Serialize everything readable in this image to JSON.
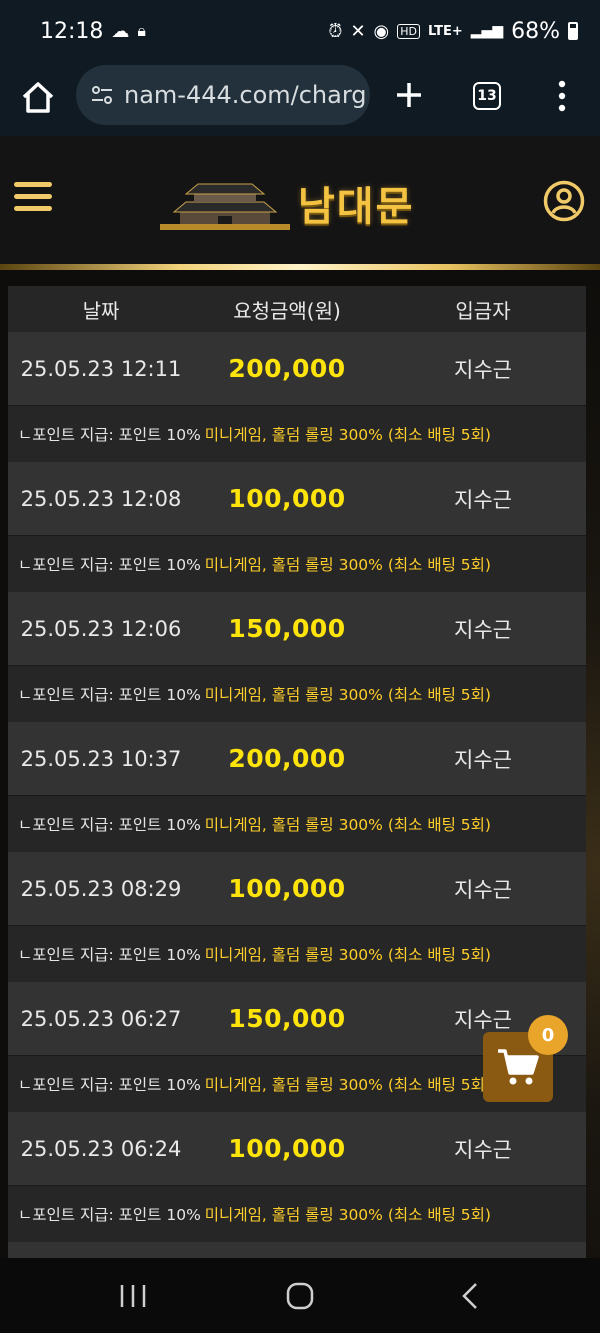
{
  "status_bar": {
    "time": "12:18",
    "battery": "68%",
    "network": "LTE+"
  },
  "browser": {
    "url": "nam-444.com/charg",
    "tab_count": "13"
  },
  "site": {
    "logo_text": "남대문"
  },
  "table": {
    "headers": [
      "날짜",
      "요청금액(원)",
      "입금자"
    ],
    "rows": [
      {
        "date": "25.05.23 12:11",
        "amount": "200,000",
        "name": "지수근"
      },
      {
        "date": "25.05.23 12:08",
        "amount": "100,000",
        "name": "지수근"
      },
      {
        "date": "25.05.23 12:06",
        "amount": "150,000",
        "name": "지수근"
      },
      {
        "date": "25.05.23 10:37",
        "amount": "200,000",
        "name": "지수근"
      },
      {
        "date": "25.05.23 08:29",
        "amount": "100,000",
        "name": "지수근"
      },
      {
        "date": "25.05.23 06:27",
        "amount": "150,000",
        "name": "지수근"
      },
      {
        "date": "25.05.23 06:24",
        "amount": "100,000",
        "name": "지수근"
      }
    ],
    "note_part1": "ㄴ포인트 지급: 포인트 10%",
    "note_part2": "미니게임, 홀덤 롤링 300% (최소 배팅 5회)"
  },
  "cart": {
    "count": "0"
  },
  "colors": {
    "amount": "#ffe40c",
    "note_highlight": "#ffce2a",
    "gold": "#f0c969",
    "cart_bg": "#8a5a12",
    "badge_bg": "#e8a52a"
  }
}
